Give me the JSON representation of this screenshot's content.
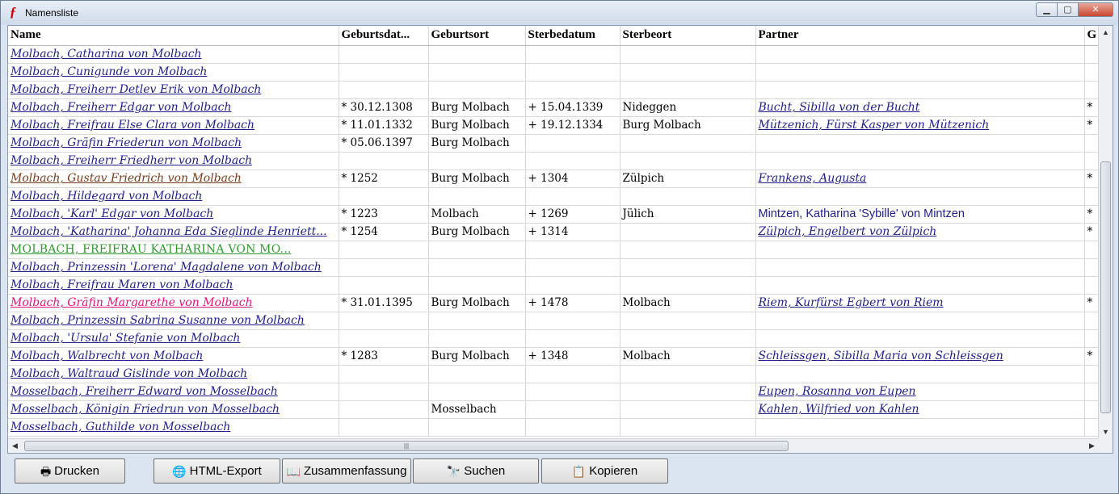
{
  "window": {
    "title": "Namensliste"
  },
  "columns": [
    "Name",
    "Geburtsdat...",
    "Geburtsort",
    "Sterbedatum",
    "Sterbeort",
    "Partner",
    "G"
  ],
  "rows": [
    {
      "name": "Molbach, Catharina von Molbach",
      "birth": "",
      "birthplace": "",
      "death": "",
      "deathplace": "",
      "partner": "",
      "extra": "",
      "style": "default"
    },
    {
      "name": "Molbach, Cunigunde von Molbach",
      "birth": "",
      "birthplace": "",
      "death": "",
      "deathplace": "",
      "partner": "",
      "extra": "",
      "style": "default"
    },
    {
      "name": "Molbach, Freiherr Detlev Erik von Molbach",
      "birth": "",
      "birthplace": "",
      "death": "",
      "deathplace": "",
      "partner": "",
      "extra": "",
      "style": "default"
    },
    {
      "name": "Molbach, Freiherr Edgar von Molbach",
      "birth": "* 30.12.1308",
      "birthplace": "Burg Molbach",
      "death": "+ 15.04.1339",
      "deathplace": "Nideggen",
      "partner": "Bucht, Sibilla von der Bucht",
      "extra": "*",
      "style": "default"
    },
    {
      "name": "Molbach, Freifrau Else Clara von Molbach",
      "birth": "* 11.01.1332",
      "birthplace": "Burg Molbach",
      "death": "+ 19.12.1334",
      "deathplace": "Burg Molbach",
      "partner": "Mützenich, Fürst Kasper von Mützenich",
      "extra": "*",
      "style": "default"
    },
    {
      "name": "Molbach, Gräfin Friederun von Molbach",
      "birth": "* 05.06.1397",
      "birthplace": "Burg Molbach",
      "death": "",
      "deathplace": "",
      "partner": "",
      "extra": "",
      "style": "default"
    },
    {
      "name": "Molbach, Freiherr Friedherr von Molbach",
      "birth": "",
      "birthplace": "",
      "death": "",
      "deathplace": "",
      "partner": "",
      "extra": "",
      "style": "default"
    },
    {
      "name": "Molbach, Gustav Friedrich von Molbach",
      "birth": "* 1252",
      "birthplace": "Burg Molbach",
      "death": "+ 1304",
      "deathplace": "Zülpich",
      "partner": "Frankens, Augusta",
      "extra": "*",
      "style": "brown"
    },
    {
      "name": "Molbach, Hildegard von Molbach",
      "birth": "",
      "birthplace": "",
      "death": "",
      "deathplace": "",
      "partner": "",
      "extra": "",
      "style": "default"
    },
    {
      "name": "Molbach, 'Karl' Edgar von Molbach",
      "birth": "* 1223",
      "birthplace": "Molbach",
      "death": "+ 1269",
      "deathplace": "Jülich",
      "partner": "Mintzen, Katharina 'Sybille' von Mintzen",
      "extra": "*",
      "style": "default",
      "partner_style": "plain"
    },
    {
      "name": "Molbach, 'Katharina' Johanna Eda Sieglinde Henriett...",
      "birth": "* 1254",
      "birthplace": "Burg Molbach",
      "death": "+ 1314",
      "deathplace": "",
      "partner": "Zülpich, Engelbert von Zülpich",
      "extra": "*",
      "style": "default"
    },
    {
      "name": "MOLBACH, FREIFRAU KATHARINA VON MO...",
      "birth": "",
      "birthplace": "",
      "death": "",
      "deathplace": "",
      "partner": "",
      "extra": "",
      "style": "green"
    },
    {
      "name": "Molbach, Prinzessin 'Lorena' Magdalene von Molbach",
      "birth": "",
      "birthplace": "",
      "death": "",
      "deathplace": "",
      "partner": "",
      "extra": "",
      "style": "default"
    },
    {
      "name": "Molbach, Freifrau Maren von Molbach",
      "birth": "",
      "birthplace": "",
      "death": "",
      "deathplace": "",
      "partner": "",
      "extra": "",
      "style": "default"
    },
    {
      "name": "Molbach, Gräfin Margarethe von Molbach",
      "birth": "* 31.01.1395",
      "birthplace": "Burg Molbach",
      "death": "+ 1478",
      "deathplace": "Molbach",
      "partner": "Riem, Kurfürst Egbert von Riem",
      "extra": "*",
      "style": "pink"
    },
    {
      "name": "Molbach, Prinzessin Sabrina Susanne von Molbach",
      "birth": "",
      "birthplace": "",
      "death": "",
      "deathplace": "",
      "partner": "",
      "extra": "",
      "style": "default"
    },
    {
      "name": "Molbach, 'Ursula' Stefanie von Molbach",
      "birth": "",
      "birthplace": "",
      "death": "",
      "deathplace": "",
      "partner": "",
      "extra": "",
      "style": "default"
    },
    {
      "name": "Molbach, Walbrecht von Molbach",
      "birth": "* 1283",
      "birthplace": "Burg Molbach",
      "death": "+ 1348",
      "deathplace": "Molbach",
      "partner": "Schleissgen, Sibilla Maria von Schleissgen",
      "extra": "*",
      "style": "default"
    },
    {
      "name": "Molbach, Waltraud Gislinde von Molbach",
      "birth": "",
      "birthplace": "",
      "death": "",
      "deathplace": "",
      "partner": "",
      "extra": "",
      "style": "default"
    },
    {
      "name": "Mosselbach, Freiherr Edward von Mosselbach",
      "birth": "",
      "birthplace": "",
      "death": "",
      "deathplace": "",
      "partner": "Eupen, Rosanna von Eupen",
      "extra": "",
      "style": "default"
    },
    {
      "name": "Mosselbach, Königin Friedrun von Mosselbach",
      "birth": "",
      "birthplace": "Mosselbach",
      "death": "",
      "deathplace": "",
      "partner": "Kahlen, Wilfried von Kahlen",
      "extra": "",
      "style": "default"
    },
    {
      "name": "Mosselbach, Guthilde von Mosselbach",
      "birth": "",
      "birthplace": "",
      "death": "",
      "deathplace": "",
      "partner": "",
      "extra": "",
      "style": "default"
    }
  ],
  "toolbar": {
    "print_label": "Drucken",
    "html_export_label": "HTML-Export",
    "summary_label": "Zusammenfassung",
    "search_label": "Suchen",
    "copy_label": "Kopieren"
  },
  "colors": {
    "link": "#1f1f8c",
    "brown": "#7a3a1a",
    "green": "#2f9a2f",
    "pink": "#e0157a"
  },
  "icons": {
    "print": "printer-icon",
    "html_export": "globe-icon",
    "summary": "book-icon",
    "search": "binoculars-icon",
    "copy": "copy-icon"
  }
}
